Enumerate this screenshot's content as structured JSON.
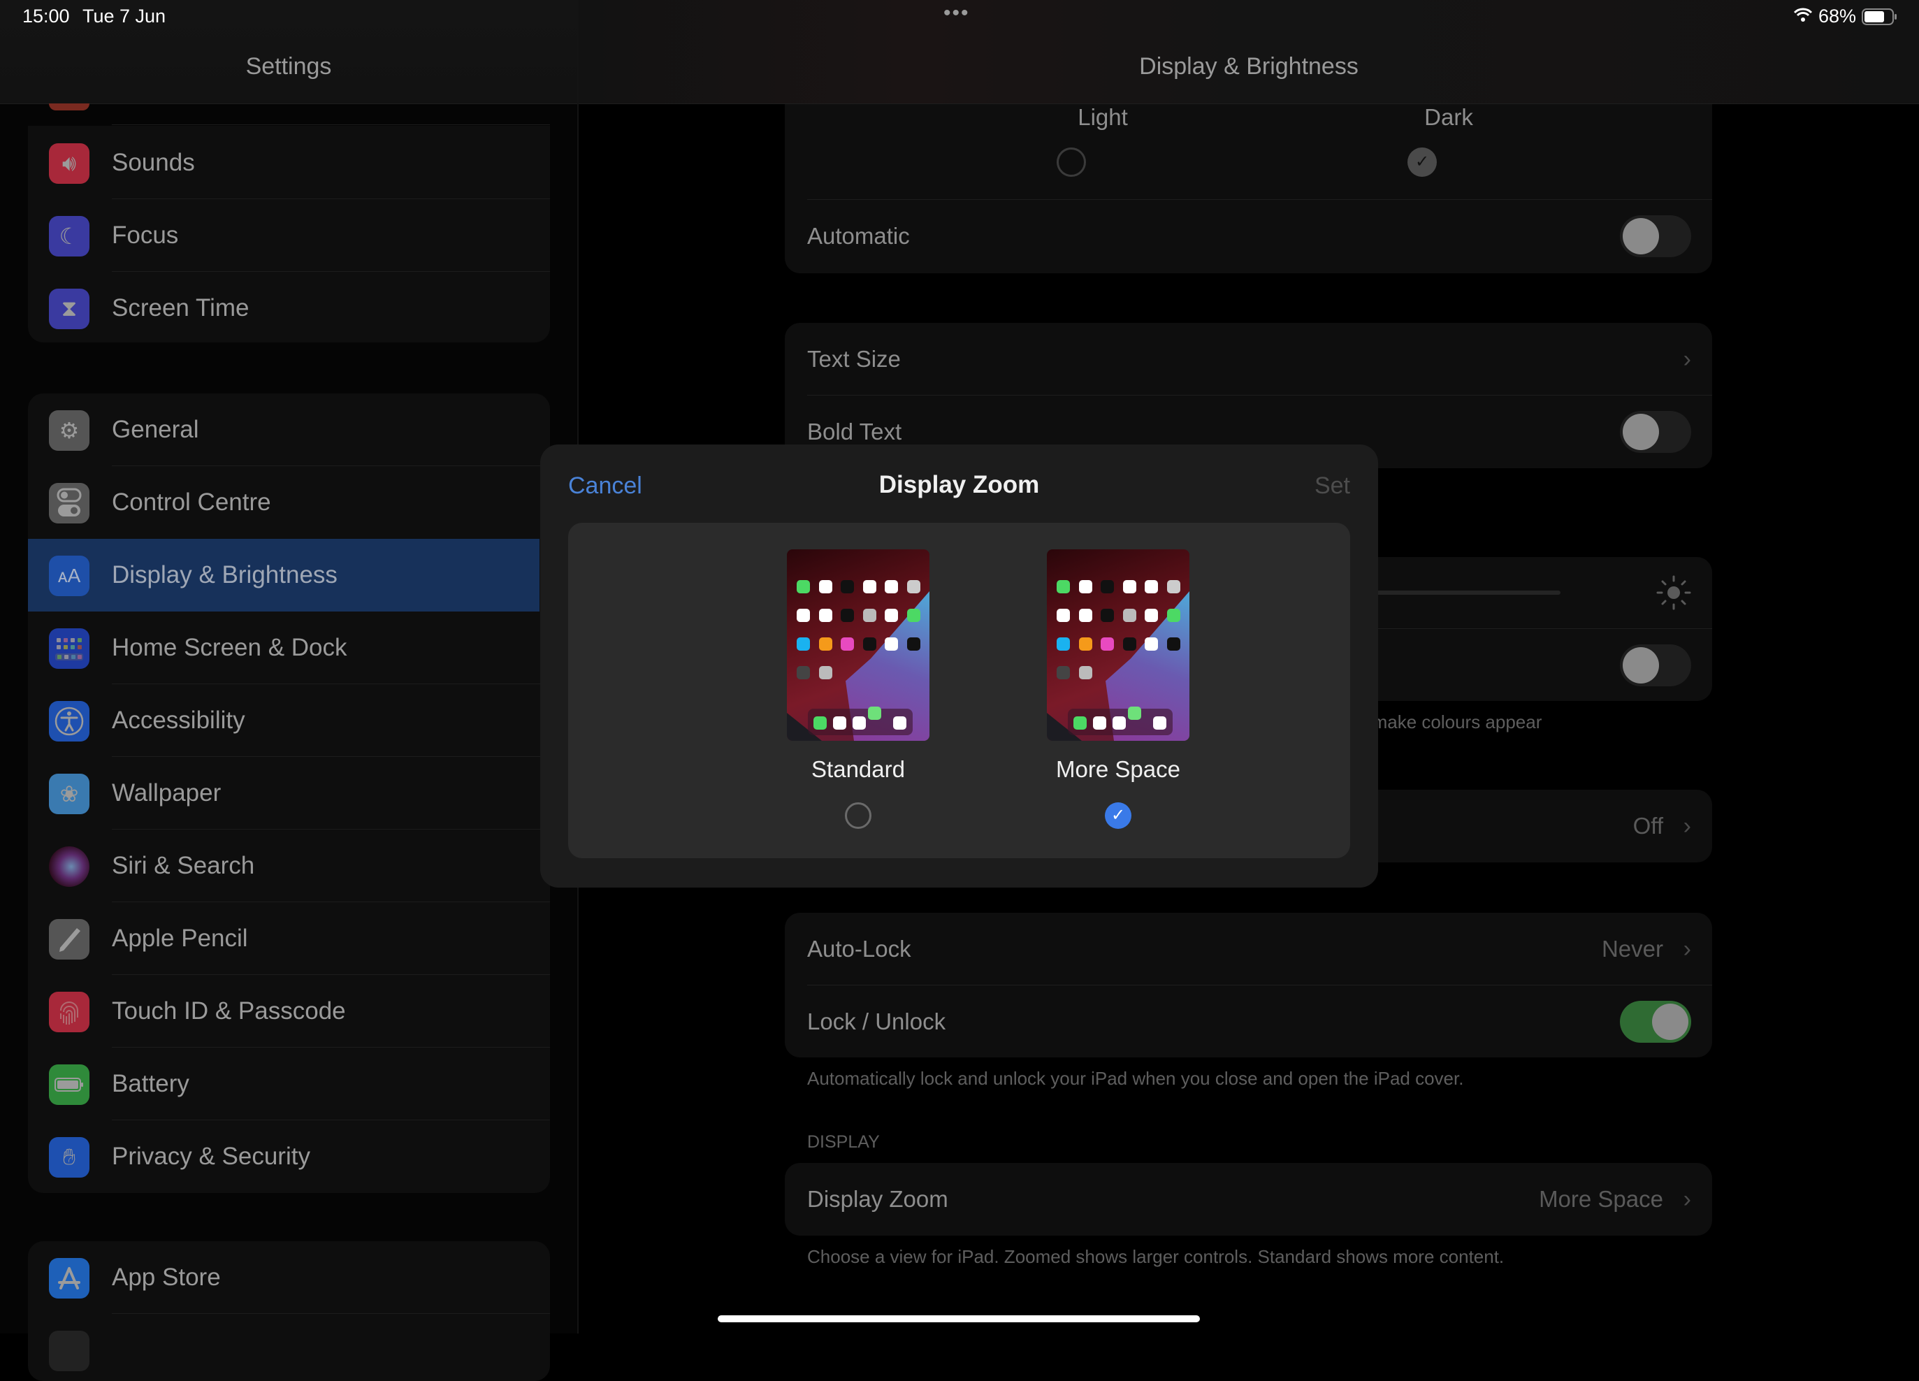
{
  "status_bar": {
    "time": "15:00",
    "date": "Tue 7 Jun",
    "multitask_dots": "•••",
    "battery_percent": "68%",
    "wifi_icon": "wifi-icon",
    "battery_icon": "battery-icon"
  },
  "sidebar": {
    "title": "Settings",
    "groups": [
      {
        "items": [
          {
            "label": "Sounds",
            "icon": "speaker-icon",
            "color": "#a8283a"
          },
          {
            "label": "Focus",
            "icon": "moon-icon",
            "color": "#3a3aa0"
          },
          {
            "label": "Screen Time",
            "icon": "hourglass-icon",
            "color": "#3a3aa0"
          }
        ]
      },
      {
        "items": [
          {
            "label": "General",
            "icon": "gear-icon",
            "color": "#555555"
          },
          {
            "label": "Control Centre",
            "icon": "toggles-icon",
            "color": "#555555"
          },
          {
            "label": "Display & Brightness",
            "icon": "text-size-icon",
            "color": "#1e4fa8",
            "selected": true
          },
          {
            "label": "Home Screen & Dock",
            "icon": "home-grid-icon",
            "color": "#1e3aa0"
          },
          {
            "label": "Accessibility",
            "icon": "accessibility-icon",
            "color": "#1e50b0"
          },
          {
            "label": "Wallpaper",
            "icon": "flower-icon",
            "color": "#3a7ab0"
          },
          {
            "label": "Siri & Search",
            "icon": "siri-icon",
            "color": "#2a1a3a"
          },
          {
            "label": "Apple Pencil",
            "icon": "pencil-icon",
            "color": "#555555"
          },
          {
            "label": "Touch ID & Passcode",
            "icon": "fingerprint-icon",
            "color": "#a8283a"
          },
          {
            "label": "Battery",
            "icon": "battery-icon",
            "color": "#2f8a3a"
          },
          {
            "label": "Privacy & Security",
            "icon": "hand-icon",
            "color": "#1e50b0"
          }
        ]
      },
      {
        "items": [
          {
            "label": "App Store",
            "icon": "app-store-icon",
            "color": "#1e60b8"
          }
        ]
      }
    ]
  },
  "detail": {
    "title": "Display & Brightness",
    "appearance": {
      "light_label": "Light",
      "dark_label": "Dark",
      "selected": "Dark",
      "automatic_label": "Automatic",
      "automatic_on": false
    },
    "text": {
      "text_size_label": "Text Size",
      "bold_text_label": "Bold Text",
      "bold_text_on": false
    },
    "brightness": {
      "level": 0.4,
      "true_tone_on": false,
      "footnote_partial": "ns to make colours appear"
    },
    "night_shift": {
      "value": "Off"
    },
    "lock": {
      "auto_lock_label": "Auto-Lock",
      "auto_lock_value": "Never",
      "lock_unlock_label": "Lock / Unlock",
      "lock_unlock_on": true,
      "footnote": "Automatically lock and unlock your iPad when you close and open the iPad cover."
    },
    "display": {
      "section_header": "DISPLAY",
      "display_zoom_label": "Display Zoom",
      "display_zoom_value": "More Space",
      "footnote": "Choose a view for iPad. Zoomed shows larger controls. Standard shows more content."
    }
  },
  "modal": {
    "title": "Display Zoom",
    "cancel_label": "Cancel",
    "set_label": "Set",
    "options": [
      {
        "label": "Standard",
        "selected": false
      },
      {
        "label": "More Space",
        "selected": true
      }
    ],
    "accent_color": "#3a7ae8"
  }
}
